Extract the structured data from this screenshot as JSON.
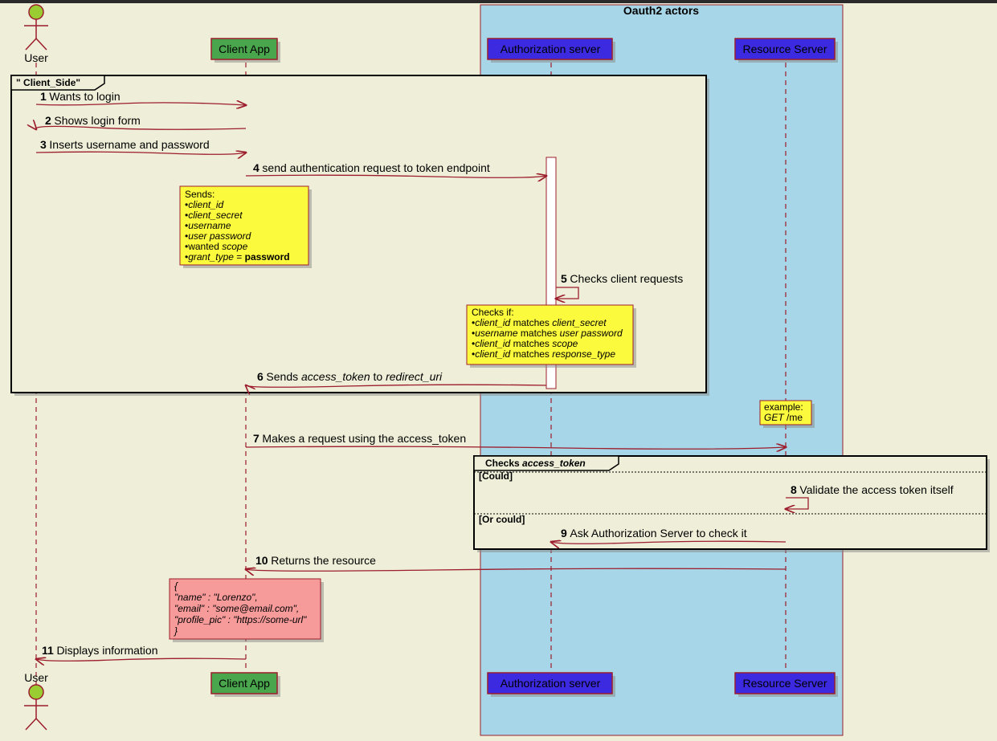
{
  "actors": {
    "user": "User",
    "client": "Client App",
    "auth": "Authorization server",
    "resource": "Resource Server"
  },
  "groupTitle": "Oauth2 actors",
  "fragment1": "\" Client_Side\"",
  "fragment2": {
    "title": "Checks access_token",
    "guard1": "[Could]",
    "guard2": "[Or could]"
  },
  "messages": {
    "m1": {
      "n": "1",
      "t": "Wants to login"
    },
    "m2": {
      "n": "2",
      "t": "Shows login form"
    },
    "m3": {
      "n": "3",
      "t": "Inserts username and password"
    },
    "m4": {
      "n": "4",
      "t": "send authentication request to token endpoint"
    },
    "m5": {
      "n": "5",
      "t": "Checks client requests"
    },
    "m6a": {
      "n": "6",
      "t": "Sends "
    },
    "m6b": "access_token",
    "m6c": " to ",
    "m6d": "redirect_uri",
    "m7": {
      "n": "7",
      "t": "Makes a request using the access_token"
    },
    "m8": {
      "n": "8",
      "t": "Validate the access token itself"
    },
    "m9": {
      "n": "9",
      "t": "Ask Authorization Server to check it"
    },
    "m10": {
      "n": "10",
      "t": "Returns the resource"
    },
    "m11": {
      "n": "11",
      "t": "Displays information"
    }
  },
  "note1": {
    "title": "Sends:",
    "l1": "client_id",
    "l2": "client_secret",
    "l3": "username",
    "l4": "user password",
    "l5a": "wanted ",
    "l5b": "scope",
    "l6a": "grant_type",
    "l6b": " = ",
    "l6c": "password"
  },
  "note2": {
    "title": "Checks if:",
    "l1a": "client_id",
    "l1b": " matches ",
    "l1c": "client_secret",
    "l2a": "username",
    "l2b": " matches ",
    "l2c": "user password",
    "l3a": "client_id",
    "l3b": " matches ",
    "l3c": "scope",
    "l4a": "client_id",
    "l4b": " matches ",
    "l4c": "response_type"
  },
  "note3": {
    "l1": "example:",
    "l2a": "GET",
    "l2b": " /me"
  },
  "note4": {
    "l1": "{",
    "l2": "\"name\" : \"Lorenzo\",",
    "l3": "\"email\" : \"some@email.com\",",
    "l4": "\"profile_pic\" : \"https://some-url\"",
    "l5": "}"
  },
  "chart_data": {
    "type": "sequence-diagram",
    "participants": [
      "User",
      "Client App",
      "Authorization server",
      "Resource Server"
    ],
    "group": {
      "name": "Oauth2 actors",
      "members": [
        "Authorization server",
        "Resource Server"
      ]
    },
    "messages": [
      {
        "num": 1,
        "from": "User",
        "to": "Client App",
        "text": "Wants to login"
      },
      {
        "num": 2,
        "from": "Client App",
        "to": "User",
        "text": "Shows login form"
      },
      {
        "num": 3,
        "from": "User",
        "to": "Client App",
        "text": "Inserts username and password"
      },
      {
        "num": 4,
        "from": "Client App",
        "to": "Authorization server",
        "text": "send authentication request to token endpoint",
        "note": "Sends: client_id, client_secret, username, user password, wanted scope, grant_type = password"
      },
      {
        "num": 5,
        "from": "Authorization server",
        "to": "Authorization server",
        "text": "Checks client requests",
        "note": "Checks if: client_id matches client_secret; username matches user password; client_id matches scope; client_id matches response_type"
      },
      {
        "num": 6,
        "from": "Authorization server",
        "to": "Client App",
        "text": "Sends access_token to redirect_uri"
      },
      {
        "num": 7,
        "from": "Client App",
        "to": "Resource Server",
        "text": "Makes a request using the access_token",
        "note": "example: GET /me"
      },
      {
        "num": 8,
        "from": "Resource Server",
        "to": "Resource Server",
        "text": "Validate the access token itself",
        "guard": "Could"
      },
      {
        "num": 9,
        "from": "Resource Server",
        "to": "Authorization server",
        "text": "Ask Authorization Server to check it",
        "guard": "Or could"
      },
      {
        "num": 10,
        "from": "Resource Server",
        "to": "Client App",
        "text": "Returns the resource",
        "note": "{ \"name\":\"Lorenzo\", \"email\":\"some@email.com\", \"profile_pic\":\"https://some-url\" }"
      },
      {
        "num": 11,
        "from": "Client App",
        "to": "User",
        "text": "Displays information"
      }
    ],
    "fragments": [
      {
        "label": "\" Client_Side\"",
        "covers_messages": [
          1,
          2,
          3,
          4,
          5,
          6
        ]
      },
      {
        "label": "Checks access_token",
        "alt": [
          {
            "guard": "Could",
            "messages": [
              8
            ]
          },
          {
            "guard": "Or could",
            "messages": [
              9
            ]
          }
        ]
      }
    ]
  }
}
